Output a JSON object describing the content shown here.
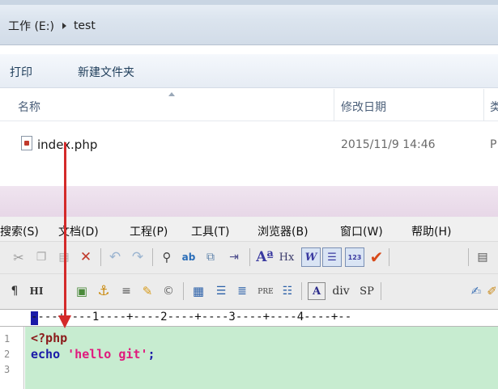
{
  "explorer": {
    "breadcrumb": {
      "drive": "工作 (E:)",
      "folder": "test"
    },
    "commands": {
      "print": "打印",
      "new_folder": "新建文件夹"
    },
    "columns": {
      "name": "名称",
      "modified": "修改日期",
      "type_cut": "类"
    },
    "file": {
      "name": "index.php",
      "modified": "2015/11/9 14:46",
      "type_cut": "P"
    }
  },
  "editor": {
    "menu": [
      "搜索(S)",
      "文档(D)",
      "工程(P)",
      "工具(T)",
      "浏览器(B)",
      "窗口(W)",
      "帮助(H)"
    ],
    "toolbar2_labels": {
      "hx": "Hx",
      "pre": "PRE",
      "div": "div",
      "sp": "SP",
      "hi": "HI"
    },
    "ruler": "----+----1----+----2----+----3----+----4----+--",
    "line_numbers": [
      "1",
      "2",
      "3"
    ],
    "code": {
      "line1": "<?php",
      "line2_keyword": "echo",
      "line2_string": "'hello git'",
      "line2_end": ";"
    }
  },
  "colors": {
    "code_background": "#c7ecd0",
    "arrow": "#d42a2a",
    "keyword": "#1a1aa8",
    "string": "#e0197d"
  }
}
